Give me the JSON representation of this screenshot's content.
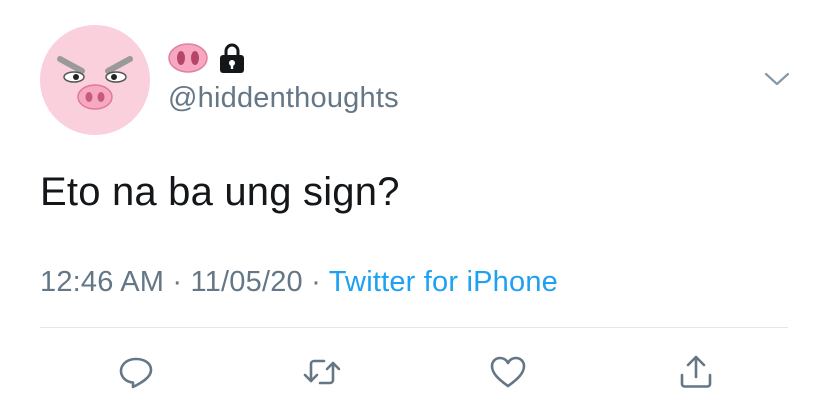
{
  "tweet": {
    "display_name_icons": [
      "pig-nose-emoji",
      "lock-icon"
    ],
    "handle": "@hiddenthoughts",
    "text": "Eto na ba ung sign?",
    "time": "12:46 AM",
    "date": "11/05/20",
    "separator": "·",
    "source": "Twitter for iPhone"
  },
  "actions": [
    {
      "name": "reply",
      "icon": "reply-icon"
    },
    {
      "name": "retweet",
      "icon": "retweet-icon"
    },
    {
      "name": "like",
      "icon": "heart-icon"
    },
    {
      "name": "share",
      "icon": "share-icon"
    }
  ],
  "colors": {
    "text": "#14171a",
    "secondary": "#657786",
    "link": "#1da1f2",
    "divider": "#e1e8ed",
    "avatar_bg": "#f9d0dc"
  }
}
